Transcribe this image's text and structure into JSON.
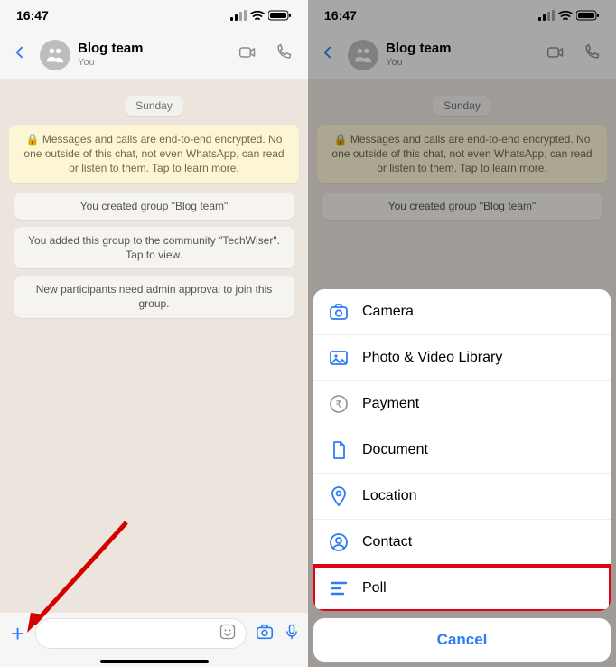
{
  "statusbar": {
    "time": "16:47"
  },
  "header": {
    "title": "Blog team",
    "subtitle": "You"
  },
  "chat": {
    "date": "Sunday",
    "e2e": "🔒 Messages and calls are end-to-end encrypted. No one outside of this chat, not even WhatsApp, can read or listen to them. Tap to learn more.",
    "sys": [
      "You created group \"Blog team\"",
      "You added this group to the community \"TechWiser\". Tap to view.",
      "New participants need admin approval to join this group."
    ]
  },
  "sheet": {
    "items": [
      {
        "label": "Camera",
        "icon": "camera"
      },
      {
        "label": "Photo & Video Library",
        "icon": "photo"
      },
      {
        "label": "Payment",
        "icon": "payment"
      },
      {
        "label": "Document",
        "icon": "document"
      },
      {
        "label": "Location",
        "icon": "location"
      },
      {
        "label": "Contact",
        "icon": "contact"
      },
      {
        "label": "Poll",
        "icon": "poll",
        "highlighted": true
      }
    ],
    "cancel": "Cancel"
  }
}
